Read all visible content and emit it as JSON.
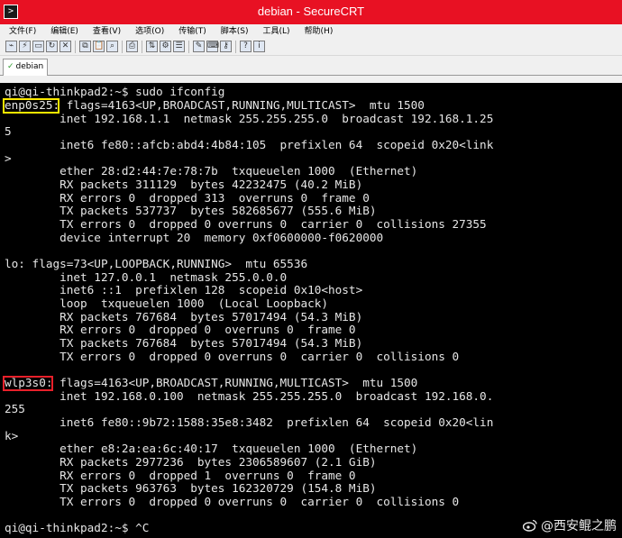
{
  "window": {
    "title": "debian - SecureCRT"
  },
  "menu": [
    "文件(F)",
    "编辑(E)",
    "查看(V)",
    "选项(O)",
    "传输(T)",
    "脚本(S)",
    "工具(L)",
    "帮助(H)"
  ],
  "tab": {
    "label": "debian"
  },
  "terminal": {
    "lines": [
      "qi@qi-thinkpad2:~$ sudo ifconfig",
      "enp0s25: flags=4163<UP,BROADCAST,RUNNING,MULTICAST>  mtu 1500",
      "        inet 192.168.1.1  netmask 255.255.255.0  broadcast 192.168.1.25",
      "5",
      "        inet6 fe80::afcb:abd4:4b84:105  prefixlen 64  scopeid 0x20<link",
      ">",
      "        ether 28:d2:44:7e:78:7b  txqueuelen 1000  (Ethernet)",
      "        RX packets 311129  bytes 42232475 (40.2 MiB)",
      "        RX errors 0  dropped 313  overruns 0  frame 0",
      "        TX packets 537737  bytes 582685677 (555.6 MiB)",
      "        TX errors 0  dropped 0 overruns 0  carrier 0  collisions 27355",
      "        device interrupt 20  memory 0xf0600000-f0620000",
      "",
      "lo: flags=73<UP,LOOPBACK,RUNNING>  mtu 65536",
      "        inet 127.0.0.1  netmask 255.0.0.0",
      "        inet6 ::1  prefixlen 128  scopeid 0x10<host>",
      "        loop  txqueuelen 1000  (Local Loopback)",
      "        RX packets 767684  bytes 57017494 (54.3 MiB)",
      "        RX errors 0  dropped 0  overruns 0  frame 0",
      "        TX packets 767684  bytes 57017494 (54.3 MiB)",
      "        TX errors 0  dropped 0 overruns 0  carrier 0  collisions 0",
      "",
      "wlp3s0: flags=4163<UP,BROADCAST,RUNNING,MULTICAST>  mtu 1500",
      "        inet 192.168.0.100  netmask 255.255.255.0  broadcast 192.168.0.",
      "255",
      "        inet6 fe80::9b72:1588:35e8:3482  prefixlen 64  scopeid 0x20<lin",
      "k>",
      "        ether e8:2a:ea:6c:40:17  txqueuelen 1000  (Ethernet)",
      "        RX packets 2977236  bytes 2306589607 (2.1 GiB)",
      "        RX errors 0  dropped 1  overruns 0  frame 0",
      "        TX packets 963763  bytes 162320729 (154.8 MiB)",
      "        TX errors 0  dropped 0 overruns 0  carrier 0  collisions 0",
      "",
      "qi@qi-thinkpad2:~$ ^C"
    ],
    "highlights": [
      {
        "text": "enp0s25",
        "color": "#ffea00"
      },
      {
        "text": "wlp3s0",
        "color": "#e8202a"
      }
    ]
  },
  "watermark": "@西安鲲之鹏",
  "colors": {
    "titlebar": "#e81123",
    "terminal_bg": "#000000",
    "terminal_fg": "#e6e6e6"
  }
}
